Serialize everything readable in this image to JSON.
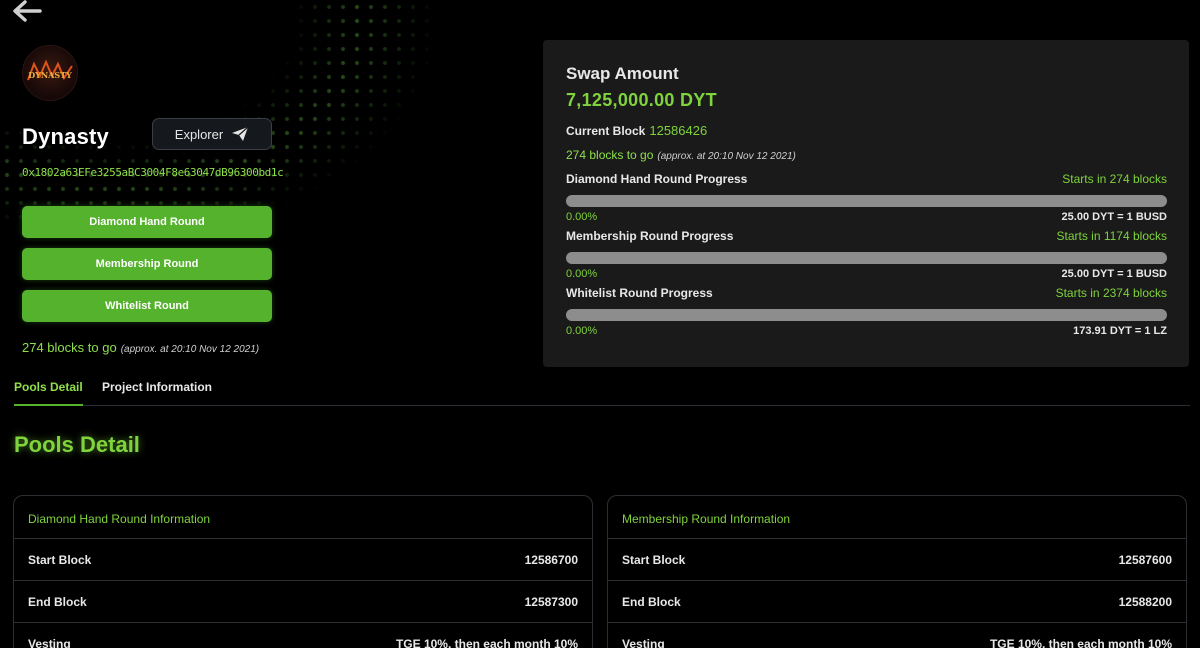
{
  "nav": {
    "back_icon": "arrow-left-icon"
  },
  "project": {
    "name": "Dynasty",
    "logo_text": "DYNASTY",
    "contract_address": "0x1802a63EFe3255aBC3004F8e63047dB96300bd1c",
    "explorer_label": "Explorer",
    "explorer_icon": "paper-plane-icon"
  },
  "rounds": {
    "buttons": [
      "Diamond Hand Round",
      "Membership Round",
      "Whitelist Round"
    ],
    "blocks_to_go": "274 blocks to go",
    "approx": "(approx. at 20:10 Nov 12 2021)"
  },
  "swap": {
    "title": "Swap Amount",
    "amount": "7,125,000.00 DYT",
    "current_block_label": "Current Block",
    "current_block_value": "12586426",
    "blocks_to_go": "274 blocks to go",
    "approx": "(approx. at 20:10 Nov 12 2021)",
    "progress": [
      {
        "label": "Diamond Hand Round Progress",
        "starts": "Starts in 274 blocks",
        "percent_text": "0.00%",
        "percent": 0,
        "rate": "25.00 DYT = 1 BUSD"
      },
      {
        "label": "Membership Round Progress",
        "starts": "Starts in 1174 blocks",
        "percent_text": "0.00%",
        "percent": 0,
        "rate": "25.00 DYT = 1 BUSD"
      },
      {
        "label": "Whitelist Round Progress",
        "starts": "Starts in 2374 blocks",
        "percent_text": "0.00%",
        "percent": 0,
        "rate": "173.91 DYT = 1 LZ"
      }
    ]
  },
  "tabs": [
    {
      "label": "Pools Detail",
      "active": true
    },
    {
      "label": "Project Information",
      "active": false
    }
  ],
  "section_title": "Pools Detail",
  "cards": [
    {
      "title": "Diamond Hand Round Information",
      "rows": [
        {
          "label": "Start Block",
          "value": "12586700"
        },
        {
          "label": "End Block",
          "value": "12587300"
        },
        {
          "label": "Vesting",
          "value": "TGE 10%, then each month 10%"
        }
      ]
    },
    {
      "title": "Membership Round Information",
      "rows": [
        {
          "label": "Start Block",
          "value": "12587600"
        },
        {
          "label": "End Block",
          "value": "12588200"
        },
        {
          "label": "Vesting",
          "value": "TGE 10%, then each month 10%"
        }
      ]
    }
  ],
  "colors": {
    "accent": "#54b22d",
    "accent_text": "#7fd33c",
    "panel": "#1a1a1a"
  }
}
